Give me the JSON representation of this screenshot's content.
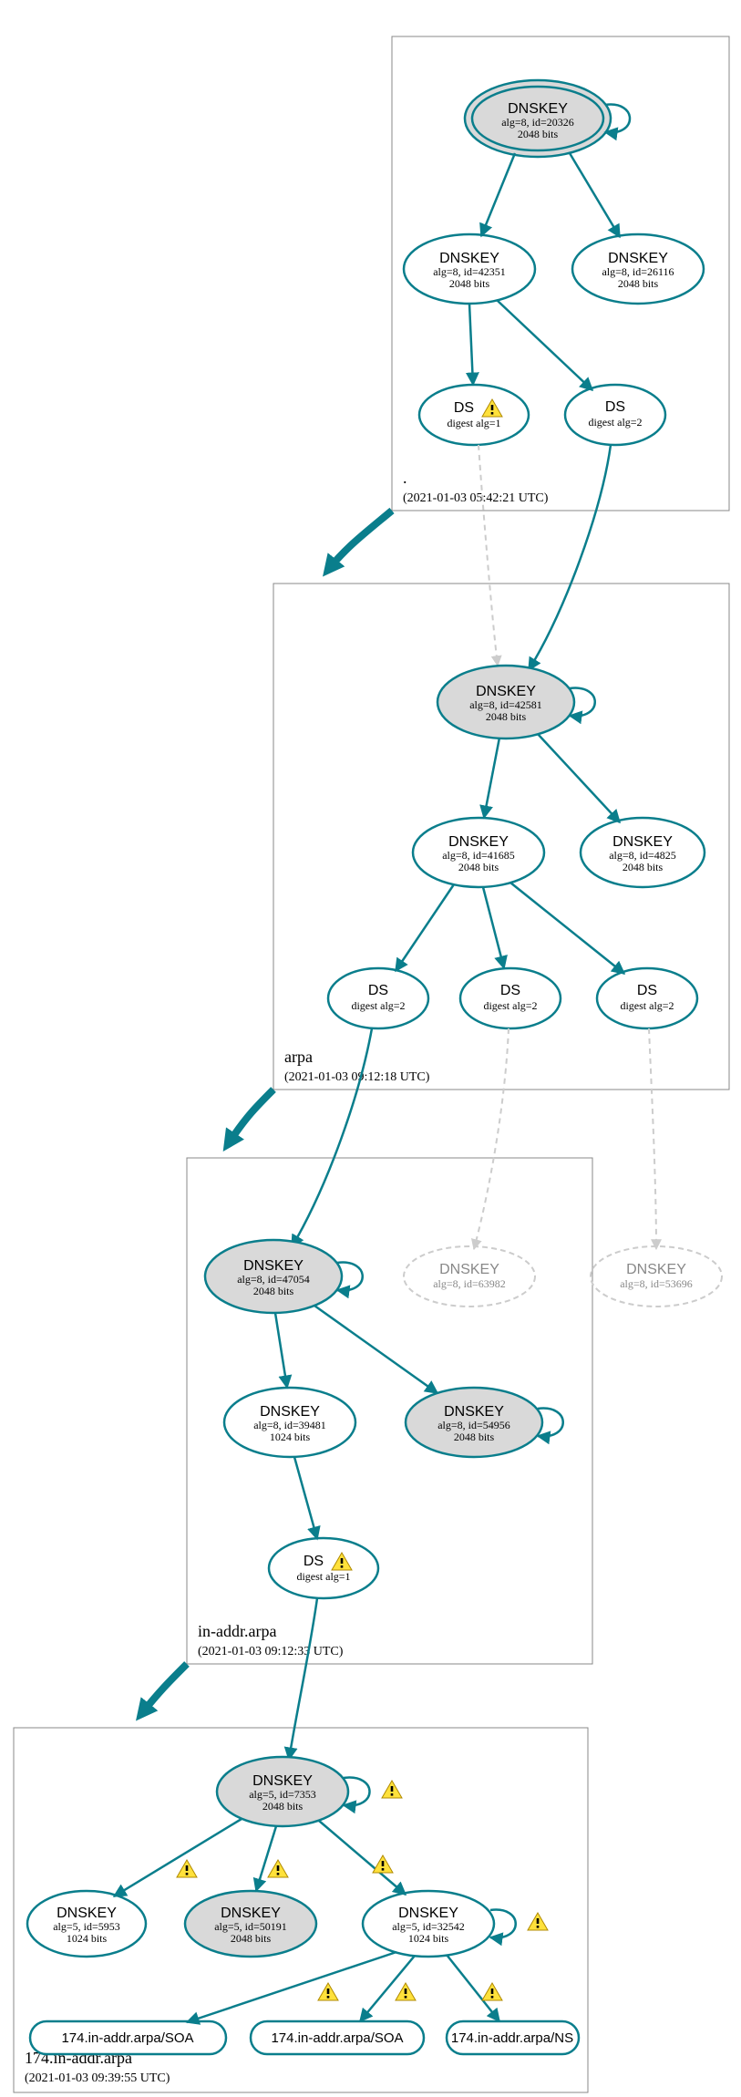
{
  "chart_data": {
    "type": "graph",
    "zones": [
      {
        "name": ".",
        "timestamp": "(2021-01-03 05:42:21 UTC)"
      },
      {
        "name": "arpa",
        "timestamp": "(2021-01-03 09:12:18 UTC)"
      },
      {
        "name": "in-addr.arpa",
        "timestamp": "(2021-01-03 09:12:33 UTC)"
      },
      {
        "name": "174.in-addr.arpa",
        "timestamp": "(2021-01-03 09:39:55 UTC)"
      }
    ],
    "nodes": {
      "root_ksk": {
        "title": "DNSKEY",
        "sub1": "alg=8, id=20326",
        "sub2": "2048 bits",
        "warn": false
      },
      "root_zsk1": {
        "title": "DNSKEY",
        "sub1": "alg=8, id=42351",
        "sub2": "2048 bits",
        "warn": false
      },
      "root_zsk2": {
        "title": "DNSKEY",
        "sub1": "alg=8, id=26116",
        "sub2": "2048 bits",
        "warn": false
      },
      "root_ds1": {
        "title": "DS",
        "sub1": "digest alg=1",
        "sub2": "",
        "warn": true
      },
      "root_ds2": {
        "title": "DS",
        "sub1": "digest alg=2",
        "sub2": "",
        "warn": false
      },
      "arpa_ksk": {
        "title": "DNSKEY",
        "sub1": "alg=8, id=42581",
        "sub2": "2048 bits",
        "warn": false
      },
      "arpa_zsk1": {
        "title": "DNSKEY",
        "sub1": "alg=8, id=41685",
        "sub2": "2048 bits",
        "warn": false
      },
      "arpa_zsk2": {
        "title": "DNSKEY",
        "sub1": "alg=8, id=4825",
        "sub2": "2048 bits",
        "warn": false
      },
      "arpa_ds1": {
        "title": "DS",
        "sub1": "digest alg=2",
        "sub2": "",
        "warn": false
      },
      "arpa_ds2": {
        "title": "DS",
        "sub1": "digest alg=2",
        "sub2": "",
        "warn": false
      },
      "arpa_ds3": {
        "title": "DS",
        "sub1": "digest alg=2",
        "sub2": "",
        "warn": false
      },
      "ina_ksk": {
        "title": "DNSKEY",
        "sub1": "alg=8, id=47054",
        "sub2": "2048 bits",
        "warn": false
      },
      "ina_d1": {
        "title": "DNSKEY",
        "sub1": "alg=8, id=63982",
        "sub2": "",
        "warn": false
      },
      "ina_d2": {
        "title": "DNSKEY",
        "sub1": "alg=8, id=53696",
        "sub2": "",
        "warn": false
      },
      "ina_zsk1": {
        "title": "DNSKEY",
        "sub1": "alg=8, id=39481",
        "sub2": "1024 bits",
        "warn": false
      },
      "ina_zsk2": {
        "title": "DNSKEY",
        "sub1": "alg=8, id=54956",
        "sub2": "2048 bits",
        "warn": false
      },
      "ina_ds": {
        "title": "DS",
        "sub1": "digest alg=1",
        "sub2": "",
        "warn": true
      },
      "z174_ksk": {
        "title": "DNSKEY",
        "sub1": "alg=5, id=7353",
        "sub2": "2048 bits",
        "warn": false
      },
      "z174_k1": {
        "title": "DNSKEY",
        "sub1": "alg=5, id=5953",
        "sub2": "1024 bits",
        "warn": false
      },
      "z174_k2": {
        "title": "DNSKEY",
        "sub1": "alg=5, id=50191",
        "sub2": "2048 bits",
        "warn": false
      },
      "z174_k3": {
        "title": "DNSKEY",
        "sub1": "alg=5, id=32542",
        "sub2": "1024 bits",
        "warn": false
      },
      "z174_soa1": {
        "title": "174.in-addr.arpa/SOA",
        "sub1": "",
        "sub2": "",
        "warn": false
      },
      "z174_soa2": {
        "title": "174.in-addr.arpa/SOA",
        "sub1": "",
        "sub2": "",
        "warn": false
      },
      "z174_ns": {
        "title": "174.in-addr.arpa/NS",
        "sub1": "",
        "sub2": "",
        "warn": false
      }
    }
  }
}
